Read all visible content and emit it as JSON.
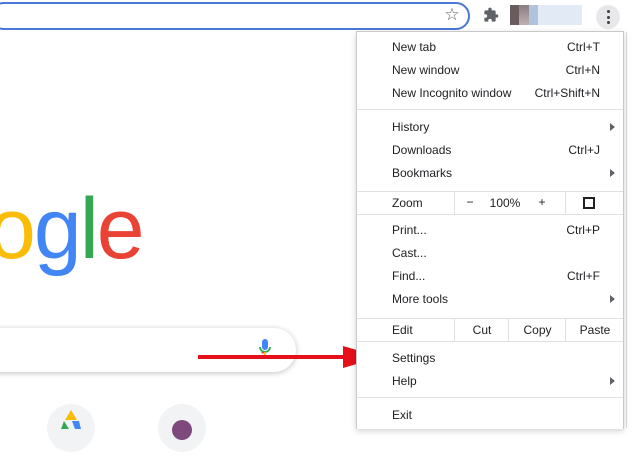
{
  "menu": {
    "new_tab": {
      "label": "New tab",
      "shortcut": "Ctrl+T"
    },
    "new_window": {
      "label": "New window",
      "shortcut": "Ctrl+N"
    },
    "new_incognito": {
      "label": "New Incognito window",
      "shortcut": "Ctrl+Shift+N"
    },
    "history": {
      "label": "History"
    },
    "downloads": {
      "label": "Downloads",
      "shortcut": "Ctrl+J"
    },
    "bookmarks": {
      "label": "Bookmarks"
    },
    "zoom": {
      "label": "Zoom",
      "minus": "−",
      "value": "100%",
      "plus": "+"
    },
    "print": {
      "label": "Print...",
      "shortcut": "Ctrl+P"
    },
    "cast": {
      "label": "Cast..."
    },
    "find": {
      "label": "Find...",
      "shortcut": "Ctrl+F"
    },
    "more_tools": {
      "label": "More tools"
    },
    "edit": {
      "label": "Edit",
      "cut": "Cut",
      "copy": "Copy",
      "paste": "Paste"
    },
    "settings": {
      "label": "Settings"
    },
    "help": {
      "label": "Help"
    },
    "exit": {
      "label": "Exit"
    }
  },
  "logo": {
    "letters": [
      "o",
      "g",
      "l",
      "e"
    ],
    "colors": [
      "#fbbc05",
      "#4285f4",
      "#34a853",
      "#ea4335"
    ]
  },
  "icons": {
    "star": "star-icon",
    "extensions": "puzzle-icon",
    "menu": "three-dots-vertical-icon",
    "mic": "microphone-icon"
  },
  "colors": {
    "arrow": "#e5101a",
    "omnibox_border": "#4a78d4"
  }
}
